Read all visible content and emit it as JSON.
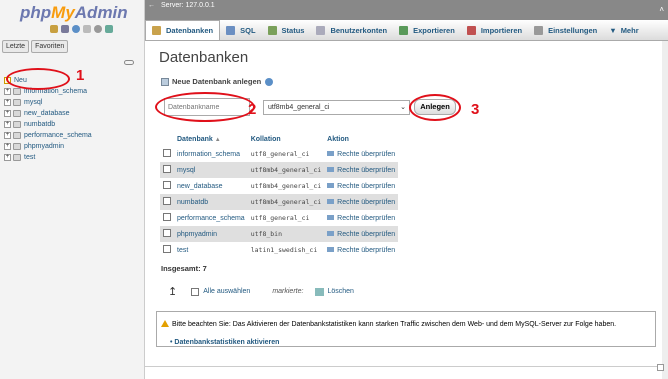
{
  "logo": {
    "part1": "php",
    "part2": "My",
    "part3": "Admin"
  },
  "left_tabs": [
    "Letzte",
    "Favoriten"
  ],
  "tree": {
    "new_label": "Neu",
    "databases": [
      "information_schema",
      "mysql",
      "new_database",
      "numbatdb",
      "performance_schema",
      "phpmyadmin",
      "test"
    ]
  },
  "server_bar": {
    "label": "Server: 127.0.0.1"
  },
  "tabs": [
    {
      "label": "Datenbanken",
      "icon": "database-icon"
    },
    {
      "label": "SQL",
      "icon": "sql-icon"
    },
    {
      "label": "Status",
      "icon": "status-icon"
    },
    {
      "label": "Benutzerkonten",
      "icon": "users-icon"
    },
    {
      "label": "Exportieren",
      "icon": "export-icon"
    },
    {
      "label": "Importieren",
      "icon": "import-icon"
    },
    {
      "label": "Einstellungen",
      "icon": "settings-icon"
    },
    {
      "label": "Mehr",
      "icon": "more-icon"
    }
  ],
  "main": {
    "title": "Datenbanken",
    "create_header": "Neue Datenbank anlegen",
    "dbname_placeholder": "Datenbankname",
    "collation_value": "utf8mb4_general_ci",
    "create_button": "Anlegen",
    "table_headers": {
      "database": "Datenbank",
      "collation": "Kollation",
      "action": "Aktion"
    },
    "rows": [
      {
        "name": "information_schema",
        "collation": "utf8_general_ci",
        "action": "Rechte überprüfen"
      },
      {
        "name": "mysql",
        "collation": "utf8mb4_general_ci",
        "action": "Rechte überprüfen"
      },
      {
        "name": "new_database",
        "collation": "utf8mb4_general_ci",
        "action": "Rechte überprüfen"
      },
      {
        "name": "numbatdb",
        "collation": "utf8mb4_general_ci",
        "action": "Rechte überprüfen"
      },
      {
        "name": "performance_schema",
        "collation": "utf8_general_ci",
        "action": "Rechte überprüfen"
      },
      {
        "name": "phpmyadmin",
        "collation": "utf8_bin",
        "action": "Rechte überprüfen"
      },
      {
        "name": "test",
        "collation": "latin1_swedish_ci",
        "action": "Rechte überprüfen"
      }
    ],
    "total": "Insgesamt: 7",
    "select_all": "Alle auswählen",
    "marked": "markierte:",
    "delete": "Löschen",
    "notice": "Bitte beachten Sie: Das Aktivieren der Datenbankstatistiken kann starken Traffic zwischen dem Web- und dem MySQL-Server zur Folge haben.",
    "stats_link": "Datenbankstatistiken aktivieren"
  },
  "annotations": [
    "1",
    "2",
    "3"
  ],
  "colors": {
    "annotation_red": "#e0101a",
    "link_blue": "#235a81",
    "logo_orange": "#f89c0e",
    "logo_purple": "#6c78af"
  }
}
